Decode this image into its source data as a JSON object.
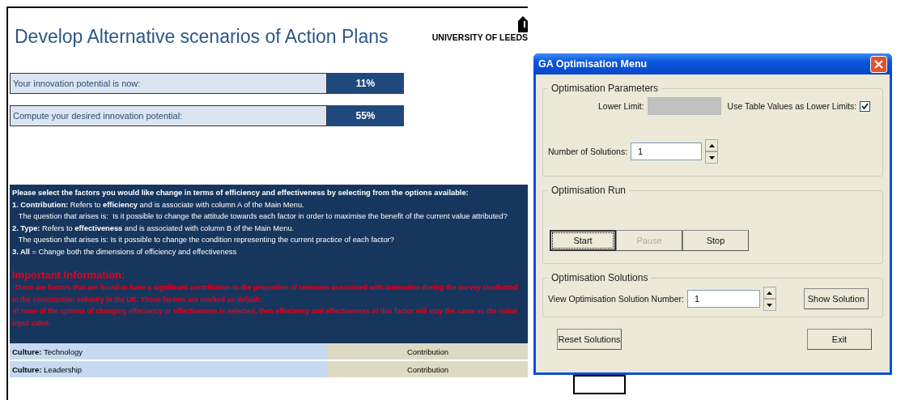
{
  "sheet": {
    "title": "Develop Alternative scenarios of Action Plans",
    "logo_text": "UNIVERSITY OF LEEDS",
    "potentials": [
      {
        "label": "Your innovation potential is now:",
        "value": "11%"
      },
      {
        "label": "Compute your desired innovation potential:",
        "value": "55%"
      }
    ],
    "instructions": [
      "**Please select the factors you would like change in terms of efficiency and effectiveness by selecting from the options available:**",
      "**1. Contribution:** Refers to **efficiency** and is associate with column A of the Main Menu.",
      "   The question that arises is:  Is it possible to change the attitude towards each factor in order to maximise the benefit of the current value attributed?",
      "**2. Type:** Refers to **effectiveness** and is associated with column B of the Main Menu.",
      "   The question that arises is: Is it possible to change the condition representing the current practice of each factor?",
      "**3. All** = Change both the dimensions of efficiency and effectiveness"
    ],
    "important_title": "Important Information:",
    "important": [
      "-There are factors that are found to have a significant contribution to the proportion of revenues associated with innovation during the survey conducted in the construction industry in the UK.  Those factors are marked as default.",
      "-If none of the options of changing effeciency or effectiveness is selected, then effeciency and effectiveness of this factor will stay the same as the initial input value."
    ],
    "factors": [
      {
        "category": "Culture:",
        "name": "Technology",
        "option": "Contribution"
      },
      {
        "category": "Culture:",
        "name": "Leadership",
        "option": "Contribution"
      }
    ]
  },
  "dialog": {
    "title": "GA Optimisation Menu",
    "parameters": {
      "legend": "Optimisation Parameters",
      "lower_limit_label": "Lower Limit:",
      "lower_limit_disabled": true,
      "use_table_label": "Use Table Values as Lower Limits:",
      "use_table_checked": true,
      "solutions_label": "Number of Solutions:",
      "solutions_value": "1"
    },
    "run": {
      "legend": "Optimisation Run",
      "buttons": [
        {
          "label": "Start",
          "focused": true,
          "disabled": false
        },
        {
          "label": "Pause",
          "focused": false,
          "disabled": true
        },
        {
          "label": "Stop",
          "focused": false,
          "disabled": false
        }
      ]
    },
    "solutions": {
      "legend": "Optimisation Solutions",
      "view_label": "View Optimisation Solution Number:",
      "view_value": "1",
      "show_button": "Show Solution"
    },
    "buttons": [
      "Reset Solutions",
      "Exit"
    ]
  }
}
